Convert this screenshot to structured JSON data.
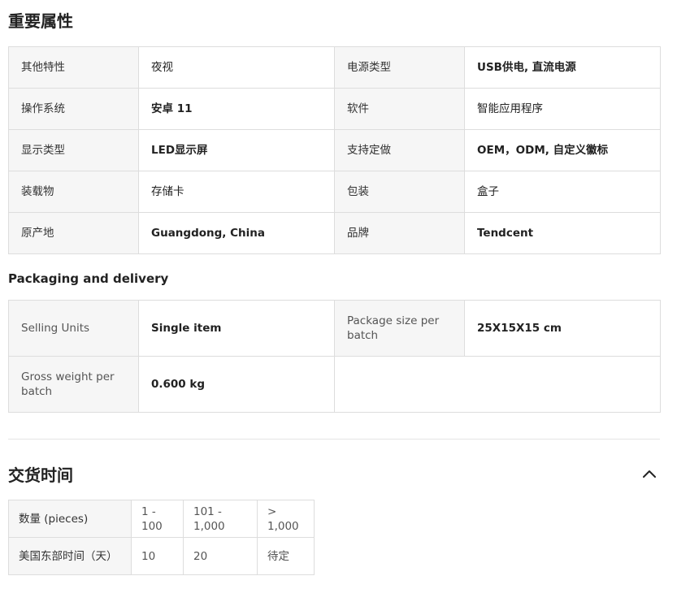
{
  "attributes": {
    "title": "重要属性",
    "rows": [
      [
        {
          "key": "其他特性",
          "value": "夜视"
        },
        {
          "key": "电源类型",
          "value": "USB供电, 直流电源"
        }
      ],
      [
        {
          "key": "操作系统",
          "value": "安卓 11"
        },
        {
          "key": "软件",
          "value": "智能应用程序"
        }
      ],
      [
        {
          "key": "显示类型",
          "value": "LED显示屏"
        },
        {
          "key": "支持定做",
          "value": "OEM，ODM, 自定义徽标"
        }
      ],
      [
        {
          "key": "装载物",
          "value": "存储卡"
        },
        {
          "key": "包装",
          "value": "盒子"
        }
      ],
      [
        {
          "key": "原产地",
          "value": "Guangdong, China"
        },
        {
          "key": "品牌",
          "value": "Tendcent"
        }
      ]
    ]
  },
  "packaging": {
    "title": "Packaging and delivery",
    "rows": [
      [
        {
          "key": "Selling Units",
          "value": "Single item"
        },
        {
          "key": "Package size per batch",
          "value": "25X15X15 cm"
        }
      ],
      [
        {
          "key": "Gross weight per batch",
          "value": "0.600 kg"
        }
      ]
    ]
  },
  "delivery": {
    "title": "交货时间",
    "collapse_icon": "chevron-up-icon",
    "header": [
      "数量 (pieces)",
      "1 - 100",
      "101 - 1,000",
      "> 1,000"
    ],
    "row": [
      "美国东部时间（天）",
      "10",
      "20",
      "待定"
    ]
  }
}
